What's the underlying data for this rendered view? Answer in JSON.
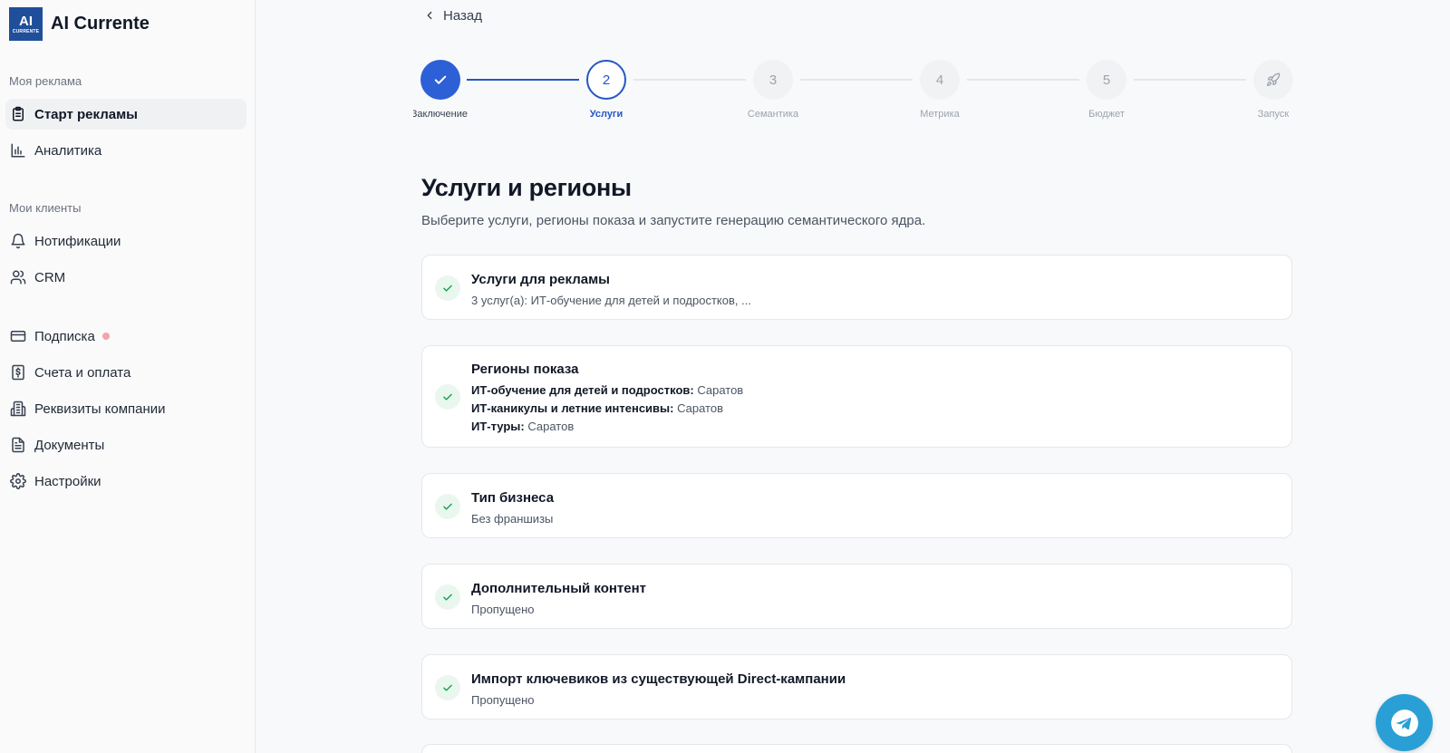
{
  "brand": {
    "logo_text": "AI",
    "logo_sub": "CURRENTE",
    "name": "AI Currente"
  },
  "sidebar": {
    "section_ads": "Моя реклама",
    "section_clients": "Мои клиенты",
    "items": [
      {
        "label": "Старт рекламы",
        "icon": "clipboard-icon",
        "active": true
      },
      {
        "label": "Аналитика",
        "icon": "bar-chart-icon"
      },
      {
        "label": "Нотификации",
        "icon": "bell-icon"
      },
      {
        "label": "CRM",
        "icon": "users-icon"
      },
      {
        "label": "Подписка",
        "icon": "credit-card-icon",
        "badge_color": "#f4a3a8"
      },
      {
        "label": "Счета и оплата",
        "icon": "dollar-receipt-icon"
      },
      {
        "label": "Реквизиты компании",
        "icon": "building-icon"
      },
      {
        "label": "Документы",
        "icon": "document-icon"
      },
      {
        "label": "Настройки",
        "icon": "gear-icon"
      }
    ]
  },
  "back": {
    "label": "Назад"
  },
  "stepper": {
    "steps": [
      {
        "number": "",
        "label": "Заключение",
        "state": "done"
      },
      {
        "number": "2",
        "label": "Услуги",
        "state": "current"
      },
      {
        "number": "3",
        "label": "Семантика",
        "state": "pending"
      },
      {
        "number": "4",
        "label": "Метрика",
        "state": "pending"
      },
      {
        "number": "5",
        "label": "Бюджет",
        "state": "pending"
      },
      {
        "number": "",
        "label": "Запуск",
        "state": "pending",
        "icon": "rocket-icon"
      }
    ]
  },
  "page": {
    "title": "Услуги и регионы",
    "subtitle": "Выберите услуги, регионы показа и запустите генерацию семантического ядра."
  },
  "cards": [
    {
      "title": "Услуги для рекламы",
      "lines": [
        {
          "text": "3 услуг(а): ИТ-обучение для детей и подростков, ..."
        }
      ]
    },
    {
      "title": "Регионы показа",
      "lines": [
        {
          "key": "ИТ-обучение для детей и подростков:",
          "text": " Саратов"
        },
        {
          "key": "ИТ-каникулы и летние интенсивы:",
          "text": " Саратов"
        },
        {
          "key": "ИТ-туры:",
          "text": " Саратов"
        }
      ]
    },
    {
      "title": "Тип бизнеса",
      "lines": [
        {
          "text": "Без франшизы"
        }
      ]
    },
    {
      "title": "Дополнительный контент",
      "lines": [
        {
          "text": "Пропущено"
        }
      ]
    },
    {
      "title": "Импорт ключевиков из существующей Direct-кампании",
      "lines": [
        {
          "text": "Пропущено"
        }
      ]
    }
  ],
  "colors": {
    "accent": "#2456c5",
    "check_green": "#16a34a",
    "telegram": "#2a9fd6"
  },
  "fab": {
    "icon": "telegram-icon"
  }
}
